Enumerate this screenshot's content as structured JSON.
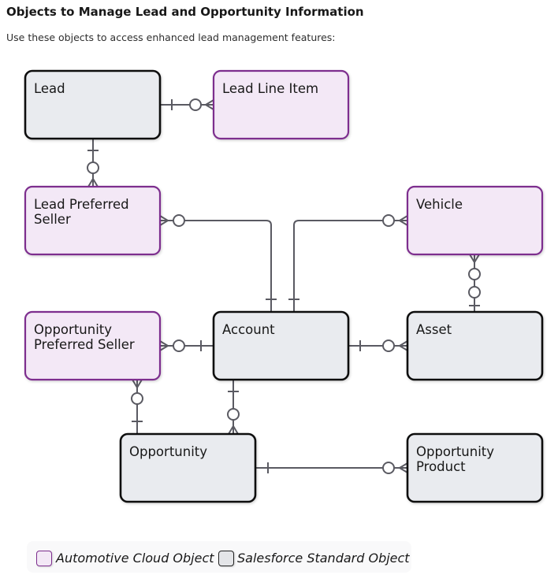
{
  "header": {
    "title": "Objects to Manage Lead and Opportunity Information",
    "subtitle": "Use these objects to access enhanced lead management features:"
  },
  "colors": {
    "automotive_fill": "#f3e8f6",
    "automotive_border": "#7d2e8e",
    "standard_fill": "#e9ebef",
    "standard_border": "#111111",
    "connector": "#5a5a62"
  },
  "entities": [
    {
      "id": "lead",
      "label": "Lead",
      "type": "standard"
    },
    {
      "id": "lead-line-item",
      "label": "Lead Line Item",
      "type": "automotive"
    },
    {
      "id": "lead-preferred-seller",
      "label": "Lead Preferred\nSeller",
      "type": "automotive"
    },
    {
      "id": "vehicle",
      "label": "Vehicle",
      "type": "automotive"
    },
    {
      "id": "opportunity-preferred-seller",
      "label": "Opportunity\nPreferred Seller",
      "type": "automotive"
    },
    {
      "id": "account",
      "label": "Account",
      "type": "standard"
    },
    {
      "id": "asset",
      "label": "Asset",
      "type": "standard"
    },
    {
      "id": "opportunity",
      "label": "Opportunity",
      "type": "standard"
    },
    {
      "id": "opportunity-product",
      "label": "Opportunity\nProduct",
      "type": "standard"
    }
  ],
  "relationships": [
    {
      "from": "lead",
      "to": "lead-line-item",
      "from_card": "one",
      "to_card": "zero-or-many"
    },
    {
      "from": "lead",
      "to": "lead-preferred-seller",
      "from_card": "one",
      "to_card": "zero-or-many"
    },
    {
      "from": "account",
      "to": "lead-preferred-seller",
      "from_card": "one",
      "to_card": "zero-or-many"
    },
    {
      "from": "account",
      "to": "vehicle",
      "from_card": "one",
      "to_card": "zero-or-many"
    },
    {
      "from": "account",
      "to": "opportunity-preferred-seller",
      "from_card": "one",
      "to_card": "zero-or-many"
    },
    {
      "from": "account",
      "to": "asset",
      "from_card": "one",
      "to_card": "zero-or-many"
    },
    {
      "from": "asset",
      "to": "vehicle",
      "from_card": "zero-or-one",
      "to_card": "zero-or-many"
    },
    {
      "from": "account",
      "to": "opportunity",
      "from_card": "one",
      "to_card": "zero-or-many"
    },
    {
      "from": "opportunity",
      "to": "opportunity-preferred-seller",
      "from_card": "one",
      "to_card": "zero-or-many"
    },
    {
      "from": "opportunity",
      "to": "opportunity-product",
      "from_card": "one",
      "to_card": "zero-or-many"
    }
  ],
  "legend": {
    "automotive_label": "Automotive Cloud Object",
    "standard_label": "Salesforce Standard Object"
  }
}
